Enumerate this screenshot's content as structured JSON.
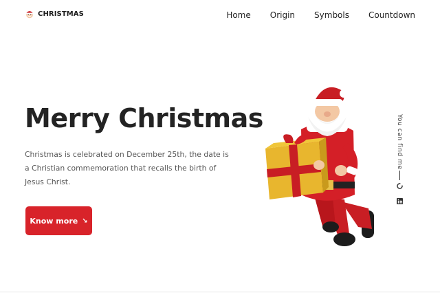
{
  "header": {
    "logo_icon": "santa-hat-icon",
    "logo_text": "CHRISTMAS",
    "nav": [
      {
        "label": "Home"
      },
      {
        "label": "Origin"
      },
      {
        "label": "Symbols"
      },
      {
        "label": "Countdown"
      }
    ]
  },
  "hero": {
    "title": "Merry Christmas",
    "text": "Christmas is celebrated on December 25th, the date is a Christian commemoration that recalls the birth of Jesus Christ.",
    "button_label": "Know more",
    "button_icon": "arrow-down-right-icon",
    "image": "santa-with-gift-illustration"
  },
  "social": {
    "label": "You can find me",
    "links": [
      {
        "icon": "github-icon"
      },
      {
        "icon": "linkedin-icon"
      }
    ]
  },
  "colors": {
    "accent": "#d8232a",
    "text": "#232323",
    "muted": "#555555",
    "background": "#ffffff"
  }
}
